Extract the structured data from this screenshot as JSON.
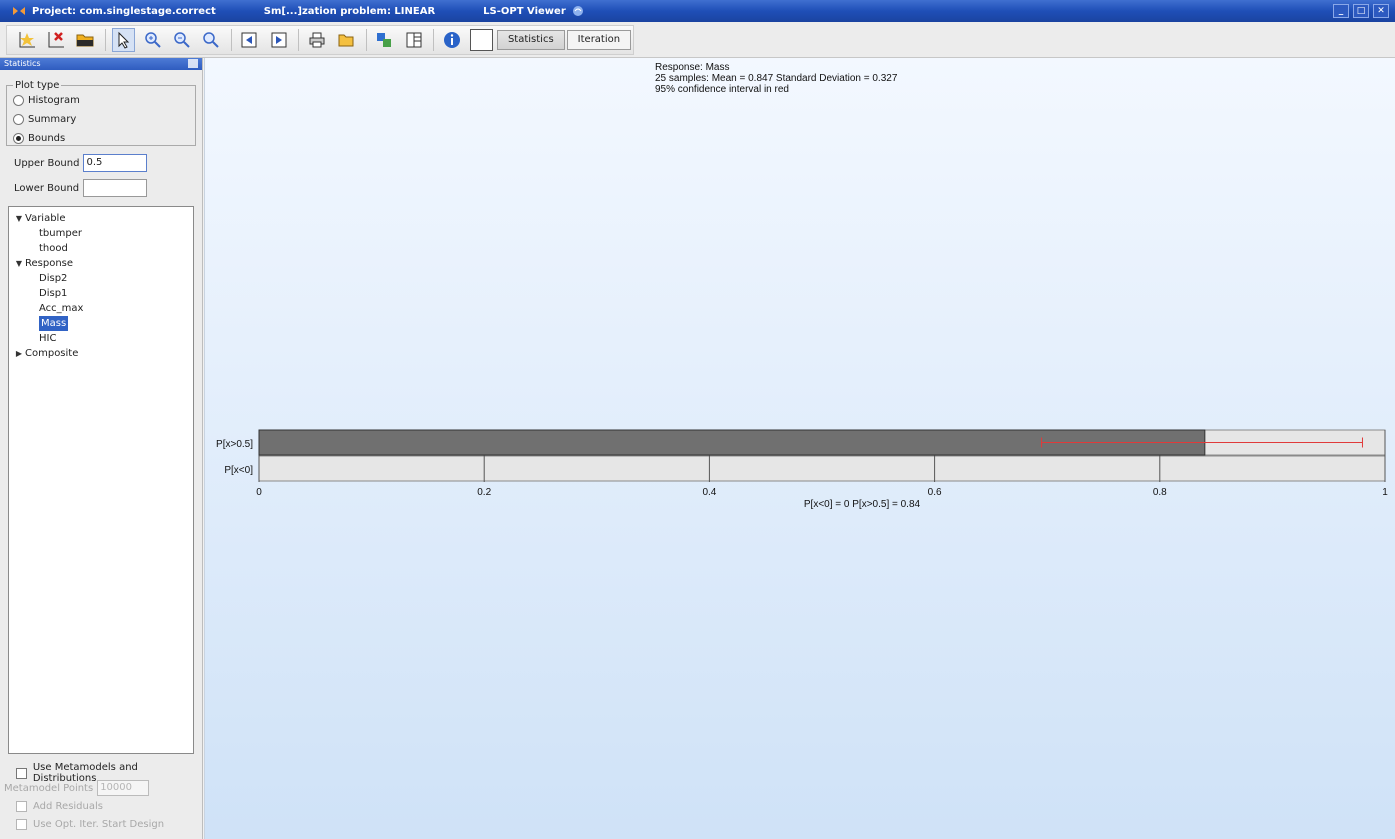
{
  "titlebar": {
    "project": "Project: com.singlestage.correct",
    "problem": "Sm[...]zation problem: LINEAR",
    "viewer": "LS-OPT Viewer"
  },
  "toolbar": {
    "tabs": [
      "Statistics",
      "Iteration"
    ],
    "selected_tab": "Statistics"
  },
  "panel": {
    "title": "Statistics",
    "plot_type_label": "Plot type",
    "plot_types": [
      "Histogram",
      "Summary",
      "Bounds"
    ],
    "selected_plot_type": "Bounds",
    "upper_bound_label": "Upper Bound",
    "upper_bound_value": "0.5",
    "lower_bound_label": "Lower Bound",
    "lower_bound_value": "",
    "tree": {
      "variable_label": "Variable",
      "variables": [
        "tbumper",
        "thood"
      ],
      "response_label": "Response",
      "responses": [
        "Disp2",
        "Disp1",
        "Acc_max",
        "Mass",
        "HIC"
      ],
      "selected_response": "Mass",
      "composite_label": "Composite"
    },
    "use_metamodels_label": "Use Metamodels and Distributions",
    "metamodel_points_label": "Metamodel Points",
    "metamodel_points_value": "10000",
    "add_residuals_label": "Add Residuals",
    "use_opt_label": "Use Opt. Iter. Start Design"
  },
  "plot": {
    "line1": "Response: Mass",
    "line2": "25 samples: Mean = 0.847   Standard Deviation = 0.327",
    "line3": "95% confidence interval in red",
    "summary": "P[x<0] = 0   P[x>0.5] = 0.84"
  },
  "chart_data": {
    "type": "bar",
    "orientation": "horizontal",
    "categories": [
      "P[x>0.5]",
      "P[x<0]"
    ],
    "values": [
      0.84,
      0
    ],
    "confidence_interval": [
      [
        0.695,
        0.98
      ],
      null
    ],
    "xlim": [
      0,
      1
    ],
    "xticks": [
      "0",
      "0.2",
      "0.4",
      "0.6",
      "0.8",
      "1"
    ],
    "grid": true,
    "colors": {
      "bar": "#707070",
      "ci": "#e03a3a",
      "track": "#e6e6e6"
    }
  }
}
